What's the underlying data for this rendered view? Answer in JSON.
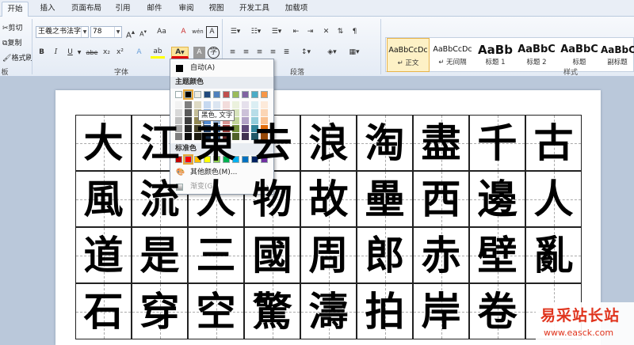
{
  "tabs": [
    "开始",
    "插入",
    "页面布局",
    "引用",
    "邮件",
    "审阅",
    "视图",
    "开发工具",
    "加载项"
  ],
  "clipboard": {
    "cut": "剪切",
    "copy": "复制",
    "format_painter": "格式刷",
    "group": "板"
  },
  "font": {
    "name": "王羲之书法字",
    "size": "78",
    "grow": "A",
    "shrink": "A",
    "change_case": "Aa",
    "clear": "A",
    "phonetic": "wén",
    "border_char": "A",
    "bold": "B",
    "italic": "I",
    "underline": "U",
    "strike": "abe",
    "subscript": "x₂",
    "superscript": "x²",
    "text_effect": "A",
    "highlight": "ab",
    "font_color": "A",
    "shading": "A",
    "enclose": "字",
    "group": "字体"
  },
  "paragraph": {
    "group": "段落"
  },
  "styles": {
    "items": [
      {
        "preview": "AaBbCcDc",
        "name": "↵ 正文",
        "selected": true
      },
      {
        "preview": "AaBbCcDc",
        "name": "↵ 无间隔",
        "selected": false
      },
      {
        "preview": "AaBb",
        "name": "标题 1",
        "selected": false
      },
      {
        "preview": "AaBbC",
        "name": "标题 2",
        "selected": false
      },
      {
        "preview": "AaBbC",
        "name": "标题",
        "selected": false
      },
      {
        "preview": "AaBbCc",
        "name": "副标题",
        "selected": false
      }
    ],
    "group": "样式"
  },
  "color_menu": {
    "auto": "自动(A)",
    "theme_header": "主题颜色",
    "standard_header": "标准色",
    "more": "其他颜色(M)...",
    "gradient": "渐变(G)",
    "tooltip": "黑色, 文字 1",
    "theme_top": [
      "#ffffff",
      "#000000",
      "#eeece1",
      "#1f497d",
      "#4f81bd",
      "#c0504d",
      "#9bbb59",
      "#8064a2",
      "#4bacc6",
      "#f79646"
    ],
    "theme_shades": [
      [
        "#f2f2f2",
        "#7f7f7f",
        "#ddd9c3",
        "#c6d9f0",
        "#dbe5f1",
        "#f2dcdb",
        "#ebf1dd",
        "#e5e0ec",
        "#dbeef3",
        "#fdeada"
      ],
      [
        "#d8d8d8",
        "#595959",
        "#c4bd97",
        "#8db3e2",
        "#b8cce4",
        "#e5b9b7",
        "#d7e3bc",
        "#ccc1d9",
        "#b7dde8",
        "#fbd5b5"
      ],
      [
        "#bfbfbf",
        "#3f3f3f",
        "#938953",
        "#548dd4",
        "#95b3d7",
        "#d99694",
        "#c3d69b",
        "#b2a2c7",
        "#92cddc",
        "#fac08f"
      ],
      [
        "#a5a5a5",
        "#262626",
        "#494429",
        "#17365d",
        "#366092",
        "#953734",
        "#76923c",
        "#5f497a",
        "#31859b",
        "#e36c09"
      ],
      [
        "#7f7f7f",
        "#0c0c0c",
        "#1d1b10",
        "#0f243e",
        "#244061",
        "#632423",
        "#4f6128",
        "#3f3151",
        "#205867",
        "#974806"
      ]
    ],
    "standard": [
      "#c00000",
      "#ff0000",
      "#ffc000",
      "#ffff00",
      "#92d050",
      "#00b050",
      "#00b0f0",
      "#0070c0",
      "#002060",
      "#7030a0"
    ]
  },
  "characters": [
    [
      "大",
      "江",
      "東",
      "去",
      "浪",
      "淘",
      "盡",
      "千",
      "古"
    ],
    [
      "風",
      "流",
      "人",
      "物",
      "故",
      "壘",
      "西",
      "邊",
      "人"
    ],
    [
      "道",
      "是",
      "三",
      "國",
      "周",
      "郎",
      "赤",
      "壁",
      "亂"
    ],
    [
      "石",
      "穿",
      "空",
      "驚",
      "濤",
      "拍",
      "岸",
      "卷",
      ""
    ]
  ],
  "watermark": {
    "title": "易采站长站",
    "url": "www.easck.com"
  }
}
